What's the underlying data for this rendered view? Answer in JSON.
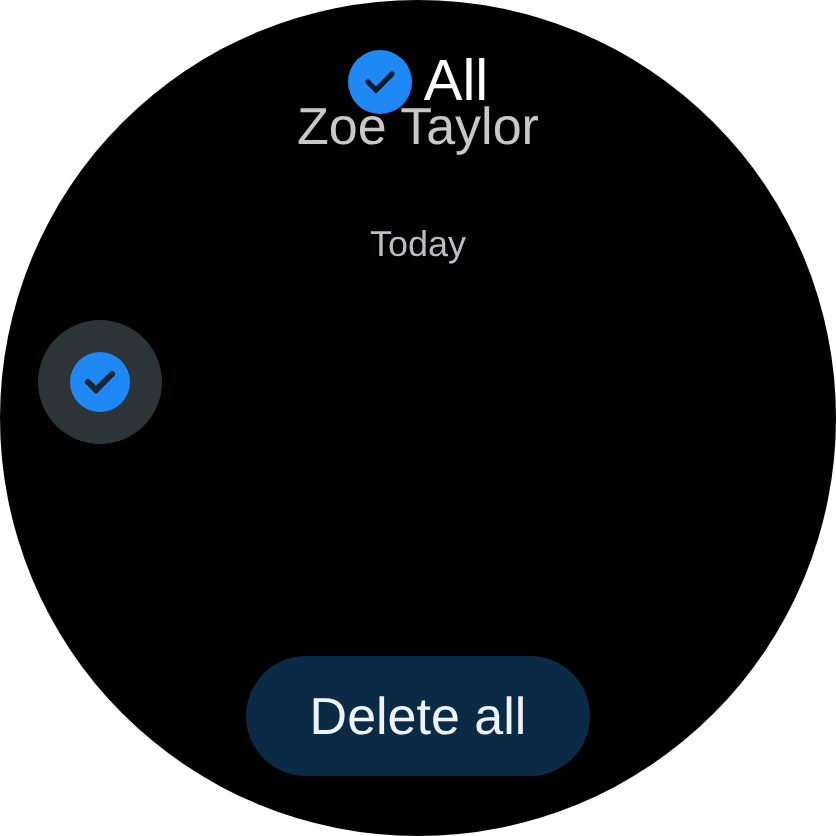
{
  "select_all": {
    "label": "All",
    "checked": true
  },
  "sender": "Zoe Taylor",
  "date_header": "Today",
  "delete_button": "Delete all"
}
